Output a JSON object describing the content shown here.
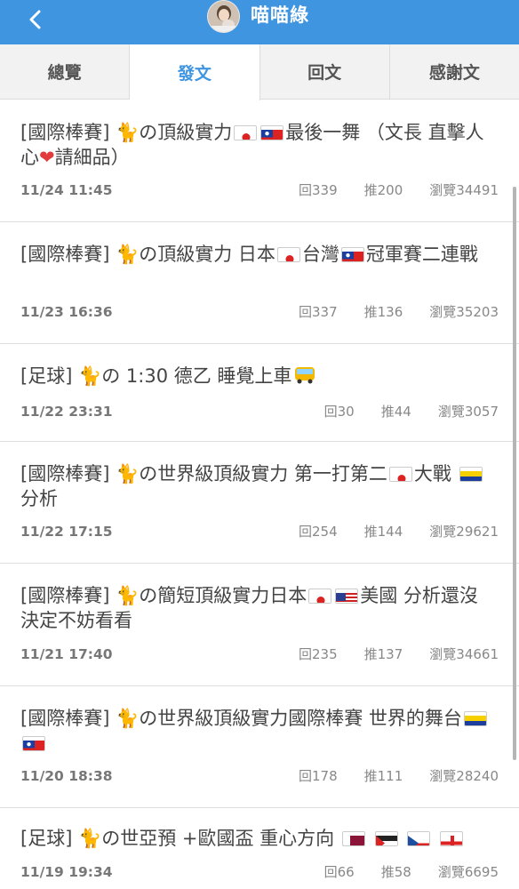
{
  "header": {
    "back_icon": "chevron-left-icon",
    "title": "喵喵綠"
  },
  "tabs": [
    {
      "label": "總覽",
      "active": false
    },
    {
      "label": "發文",
      "active": true
    },
    {
      "label": "回文",
      "active": false
    },
    {
      "label": "感謝文",
      "active": false
    }
  ],
  "posts": [
    {
      "prefix": "[國際棒賽]",
      "title_parts": [
        "の頂級實力",
        "最後一舞 （文長 直擊人心",
        "請細品）"
      ],
      "date": "11/24 11:45",
      "replies": "回339",
      "pushes": "推200",
      "views": "瀏覽34491"
    },
    {
      "prefix": "[國際棒賽]",
      "title_parts": [
        "の頂級實力 日本",
        "台灣",
        "冠軍賽二連戰"
      ],
      "date": "11/23 16:36",
      "replies": "回337",
      "pushes": "推136",
      "views": "瀏覽35203"
    },
    {
      "prefix": "[足球]",
      "title_parts": [
        "の 1:30 德乙 睡覺上車"
      ],
      "date": "11/22 23:31",
      "replies": "回30",
      "pushes": "推44",
      "views": "瀏覽3057"
    },
    {
      "prefix": "[國際棒賽]",
      "title_parts": [
        "の世界級頂級實力 第一打第二",
        "大戰",
        "分析"
      ],
      "date": "11/22 17:15",
      "replies": "回254",
      "pushes": "推144",
      "views": "瀏覽29621"
    },
    {
      "prefix": "[國際棒賽]",
      "title_parts": [
        "の簡短頂級實力日本",
        "美國 分析還沒決定不妨看看"
      ],
      "date": "11/21 17:40",
      "replies": "回235",
      "pushes": "推137",
      "views": "瀏覽34661"
    },
    {
      "prefix": "[國際棒賽]",
      "title_parts": [
        "の世界級頂級實力國際棒賽 世界的舞台"
      ],
      "date": "11/20 18:38",
      "replies": "回178",
      "pushes": "推111",
      "views": "瀏覽28240"
    },
    {
      "prefix": "[足球]",
      "title_parts": [
        "の世亞預 +歐國盃 重心方向"
      ],
      "date": "11/19 19:34",
      "replies": "回66",
      "pushes": "推58",
      "views": "瀏覽6695"
    }
  ]
}
